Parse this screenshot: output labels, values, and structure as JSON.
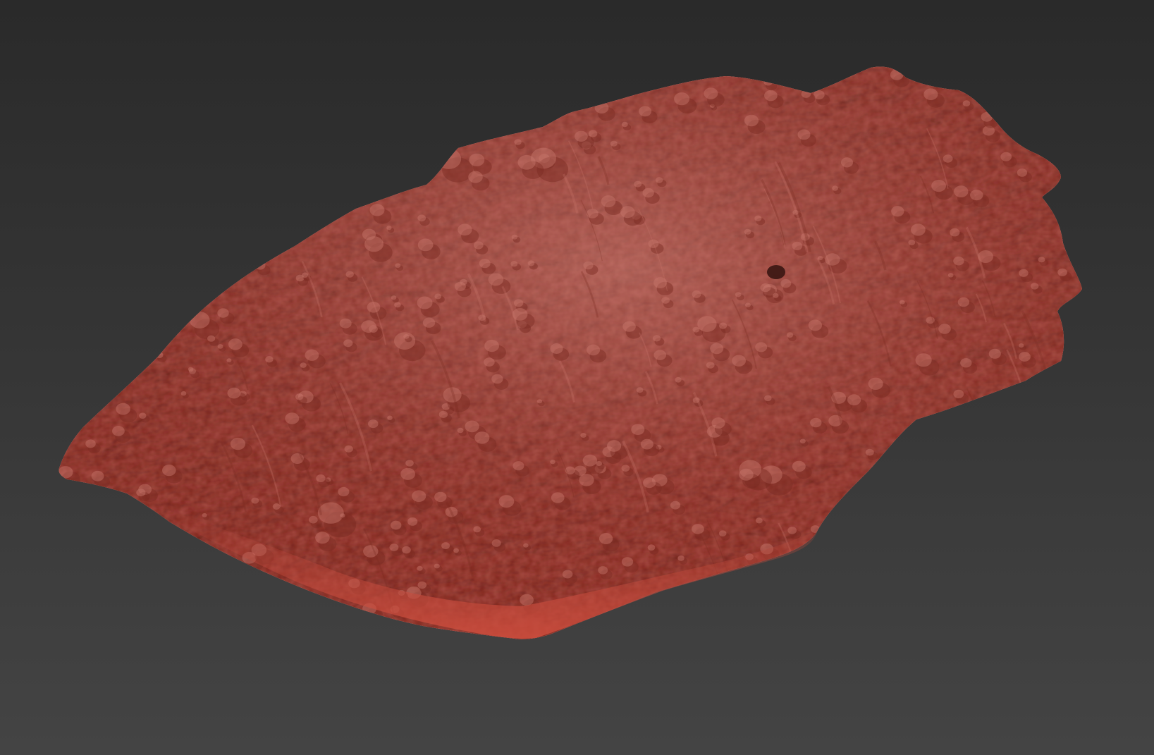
{
  "viewport": {
    "background_top": "#2a2a2a",
    "background_bottom": "#444444",
    "shading": "shaded-solid"
  },
  "model": {
    "material_color": "#b84a3e",
    "highlight_color": "#c8786c",
    "shadow_color": "#7a2a22"
  }
}
